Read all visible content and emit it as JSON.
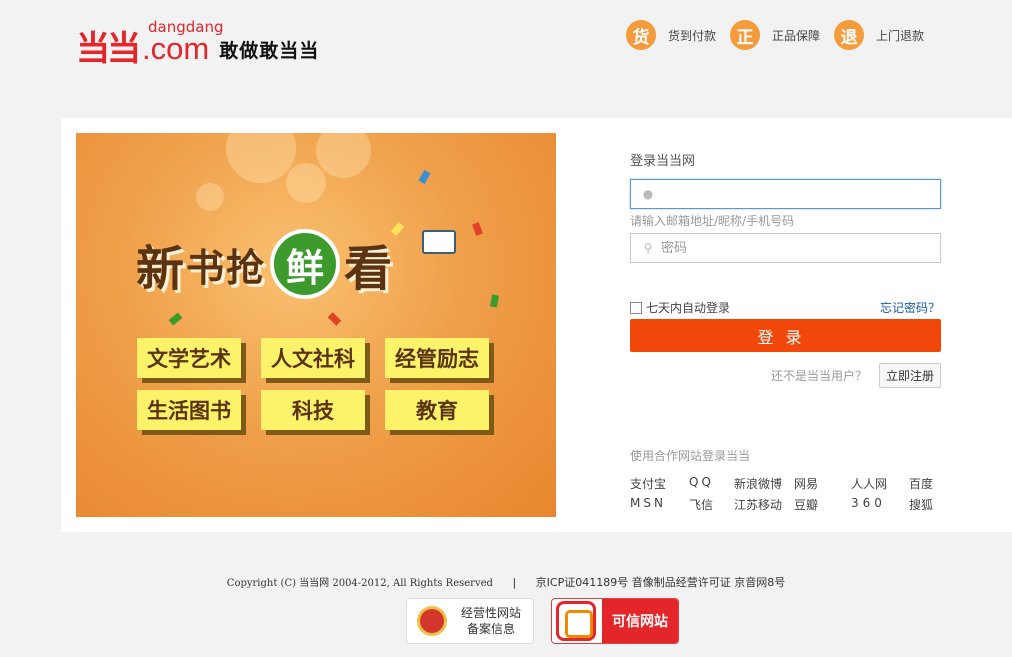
{
  "header": {
    "logo_mark": "当当",
    "logo_small": "dangdang",
    "logo_com": ".com",
    "slogan": "敢做敢当当",
    "promises": [
      {
        "icon_char": "货",
        "label": "货到付款"
      },
      {
        "icon_char": "正",
        "label": "正品保障"
      },
      {
        "icon_char": "退",
        "label": "上门退款"
      }
    ]
  },
  "banner": {
    "headline": [
      "新",
      "书",
      "抢",
      "鲜",
      "看"
    ],
    "categories": [
      "文学艺术",
      "人文社科",
      "经管励志",
      "生活图书",
      "科技",
      "教育"
    ],
    "colors": {
      "background": "#f0a04a",
      "category": "#fdf36b",
      "circle": "#3c9b2c"
    }
  },
  "login": {
    "title": "登录当当网",
    "username_value": "",
    "username_hint": "请输入邮箱地址/昵称/手机号码",
    "password_placeholder": "密码",
    "remember_label": "七天内自动登录",
    "forgot_label": "忘记密码？",
    "submit_label": "登录",
    "register_question": "还不是当当用户？",
    "register_label": "立即注册",
    "partners_title": "使用合作网站登录当当",
    "partners": [
      "支付宝",
      "QQ",
      "新浪微博",
      "网易",
      "人人网",
      "百度",
      "MSN",
      "飞信",
      "江苏移动",
      "豆瓣",
      "360",
      "搜狐"
    ],
    "accent_color": "#f2470b"
  },
  "footer": {
    "copyright": "Copyright (C) 当当网 2004-2012, All Rights Reserved",
    "separator": "|",
    "licenses": "京ICP证041189号 音像制品经营许可证 京音网8号",
    "badge1_line1": "经营性网站",
    "badge1_line2": "备案信息",
    "badge2_label": "可信网站"
  }
}
